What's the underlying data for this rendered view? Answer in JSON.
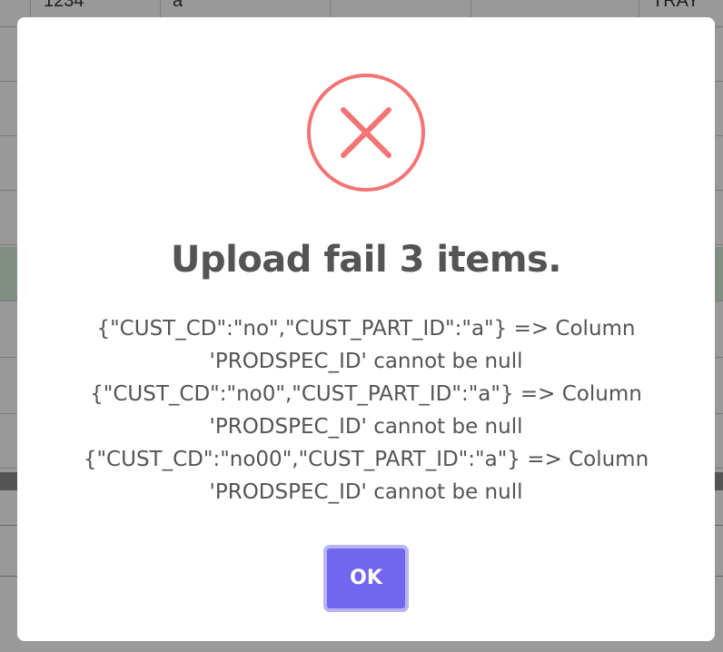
{
  "background": {
    "first_row_cells": [
      "1234",
      "a",
      "TRAY"
    ]
  },
  "dialog": {
    "icon": "error-x-circle-icon",
    "icon_color": "#f27474",
    "title": "Upload fail 3 items.",
    "message_lines": [
      "{\"CUST_CD\":\"no\",\"CUST_PART_ID\":\"a\"} => Column",
      "'PRODSPEC_ID' cannot be null",
      "{\"CUST_CD\":\"no0\",\"CUST_PART_ID\":\"a\"} => Column",
      "'PRODSPEC_ID' cannot be null",
      "{\"CUST_CD\":\"no00\",\"CUST_PART_ID\":\"a\"} => Column",
      "'PRODSPEC_ID' cannot be null"
    ],
    "ok_label": "OK",
    "ok_color": "#7367f0"
  }
}
